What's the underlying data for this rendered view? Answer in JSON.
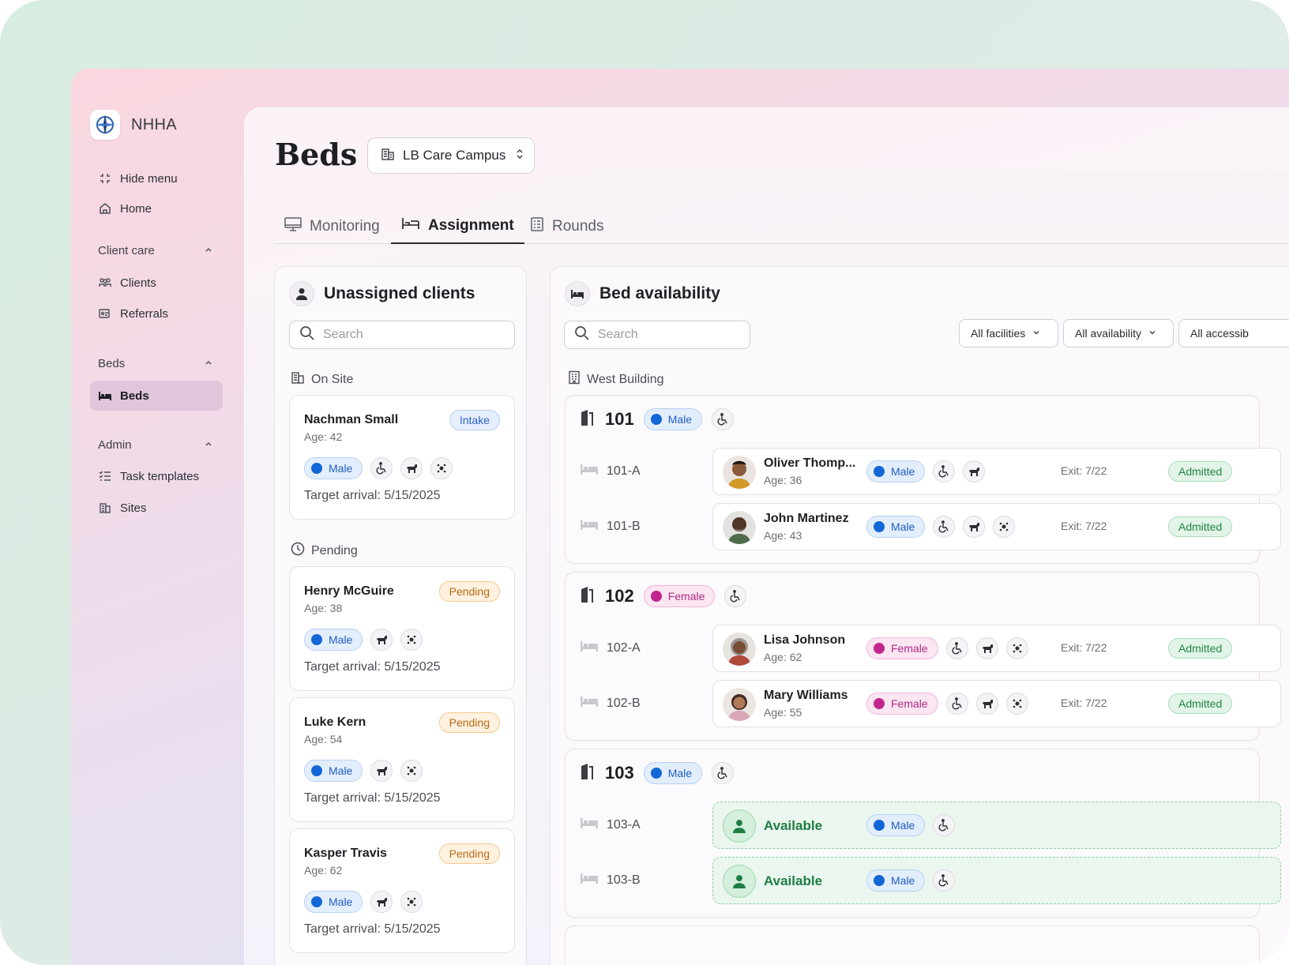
{
  "brand": {
    "name": "NHHA"
  },
  "sidebar": {
    "hide_menu": "Hide menu",
    "home": "Home",
    "sections": [
      {
        "label": "Client care",
        "items": [
          "Clients",
          "Referrals"
        ]
      },
      {
        "label": "Beds",
        "items": [
          "Beds"
        ]
      },
      {
        "label": "Admin",
        "items": [
          "Task templates",
          "Sites"
        ]
      }
    ],
    "active_item": "Beds"
  },
  "header": {
    "title": "Beds",
    "site": "LB Care Campus"
  },
  "tabs": [
    "Monitoring",
    "Assignment",
    "Rounds"
  ],
  "active_tab": "Assignment",
  "unassigned": {
    "title": "Unassigned clients",
    "search_placeholder": "Search",
    "groups": [
      {
        "label": "On Site"
      },
      {
        "label": "Pending"
      }
    ],
    "clients": [
      {
        "name": "Nachman Small",
        "age": "Age: 42",
        "status": "Intake",
        "gender": "Male",
        "icons": [
          "wheelchair-icon",
          "dog-icon",
          "allergy-icon"
        ],
        "arrival": "Target arrival: 5/15/2025"
      },
      {
        "name": "Henry McGuire",
        "age": "Age: 38",
        "status": "Pending",
        "gender": "Male",
        "icons": [
          "dog-icon",
          "allergy-icon"
        ],
        "arrival": "Target arrival: 5/15/2025"
      },
      {
        "name": "Luke Kern",
        "age": "Age: 54",
        "status": "Pending",
        "gender": "Male",
        "icons": [
          "dog-icon",
          "allergy-icon"
        ],
        "arrival": "Target arrival: 5/15/2025"
      },
      {
        "name": "Kasper Travis",
        "age": "Age: 62",
        "status": "Pending",
        "gender": "Male",
        "icons": [
          "dog-icon",
          "allergy-icon"
        ],
        "arrival": "Target arrival: 5/15/2025"
      }
    ]
  },
  "availability": {
    "title": "Bed availability",
    "search_placeholder": "Search",
    "filters": [
      "All facilities",
      "All availability",
      "All accessib"
    ],
    "building": "West Building",
    "rooms": [
      {
        "number": "101",
        "gender": "Male",
        "beds": [
          {
            "id": "101-A",
            "name": "Oliver Thomp...",
            "age": "Age: 36",
            "gender": "Male",
            "exit": "Exit: 7/22",
            "status": "Admitted",
            "icons": [
              "wheelchair-icon",
              "dog-icon"
            ]
          },
          {
            "id": "101-B",
            "name": "John Martinez",
            "age": "Age: 43",
            "gender": "Male",
            "exit": "Exit: 7/22",
            "status": "Admitted",
            "icons": [
              "wheelchair-icon",
              "dog-icon",
              "allergy-icon"
            ]
          }
        ]
      },
      {
        "number": "102",
        "gender": "Female",
        "beds": [
          {
            "id": "102-A",
            "name": "Lisa Johnson",
            "age": "Age: 62",
            "gender": "Female",
            "exit": "Exit: 7/22",
            "status": "Admitted",
            "icons": [
              "wheelchair-icon",
              "dog-icon",
              "allergy-icon"
            ]
          },
          {
            "id": "102-B",
            "name": "Mary Williams",
            "age": "Age: 55",
            "gender": "Female",
            "exit": "Exit: 7/22",
            "status": "Admitted",
            "icons": [
              "wheelchair-icon",
              "dog-icon",
              "allergy-icon"
            ]
          }
        ]
      },
      {
        "number": "103",
        "gender": "Male",
        "beds": [
          {
            "id": "103-A",
            "available": "Available",
            "gender": "Male"
          },
          {
            "id": "103-B",
            "available": "Available",
            "gender": "Male"
          }
        ]
      }
    ]
  },
  "colors": {
    "male": "#1366d6",
    "female": "#c2268e",
    "admitted": "#1f8447",
    "pending": "#b86a12",
    "intake": "#2e62c6"
  }
}
